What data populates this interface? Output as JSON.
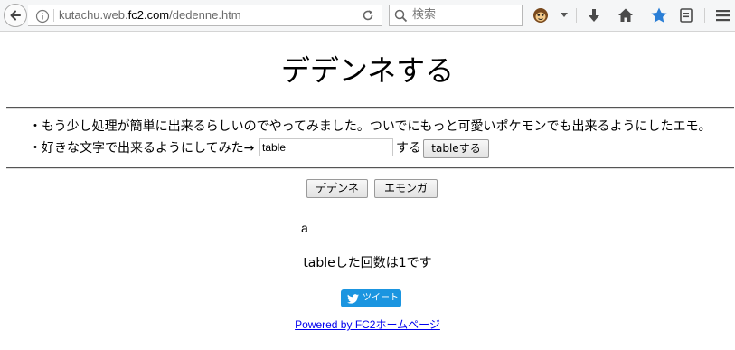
{
  "browser": {
    "url_prefix": "kutachu.web.",
    "url_host": "fc2.com",
    "url_path": "/dedenne.htm",
    "search_placeholder": "検索"
  },
  "page": {
    "title": "デデンネする",
    "line1": "・もう少し処理が簡単に出来るらしいのでやってみました。ついでにもっと可愛いポケモンでも出来るようにしたエモ。",
    "line2_prefix": "・好きな文字で出来るようにしてみた→",
    "input_value": "table",
    "line2_suffix": "する",
    "custom_button": "tableする",
    "button_dedenne": "デデンネ",
    "button_emonga": "エモンガ",
    "result_text": "a",
    "count_text": "tableした回数は1です",
    "tweet_label": "ツイート",
    "powered_by": "Powered by FC2ホームページ"
  },
  "colors": {
    "tweet_bg": "#1b95e0",
    "link": "#0000ee",
    "bookmark_star": "#2a7ed6"
  }
}
